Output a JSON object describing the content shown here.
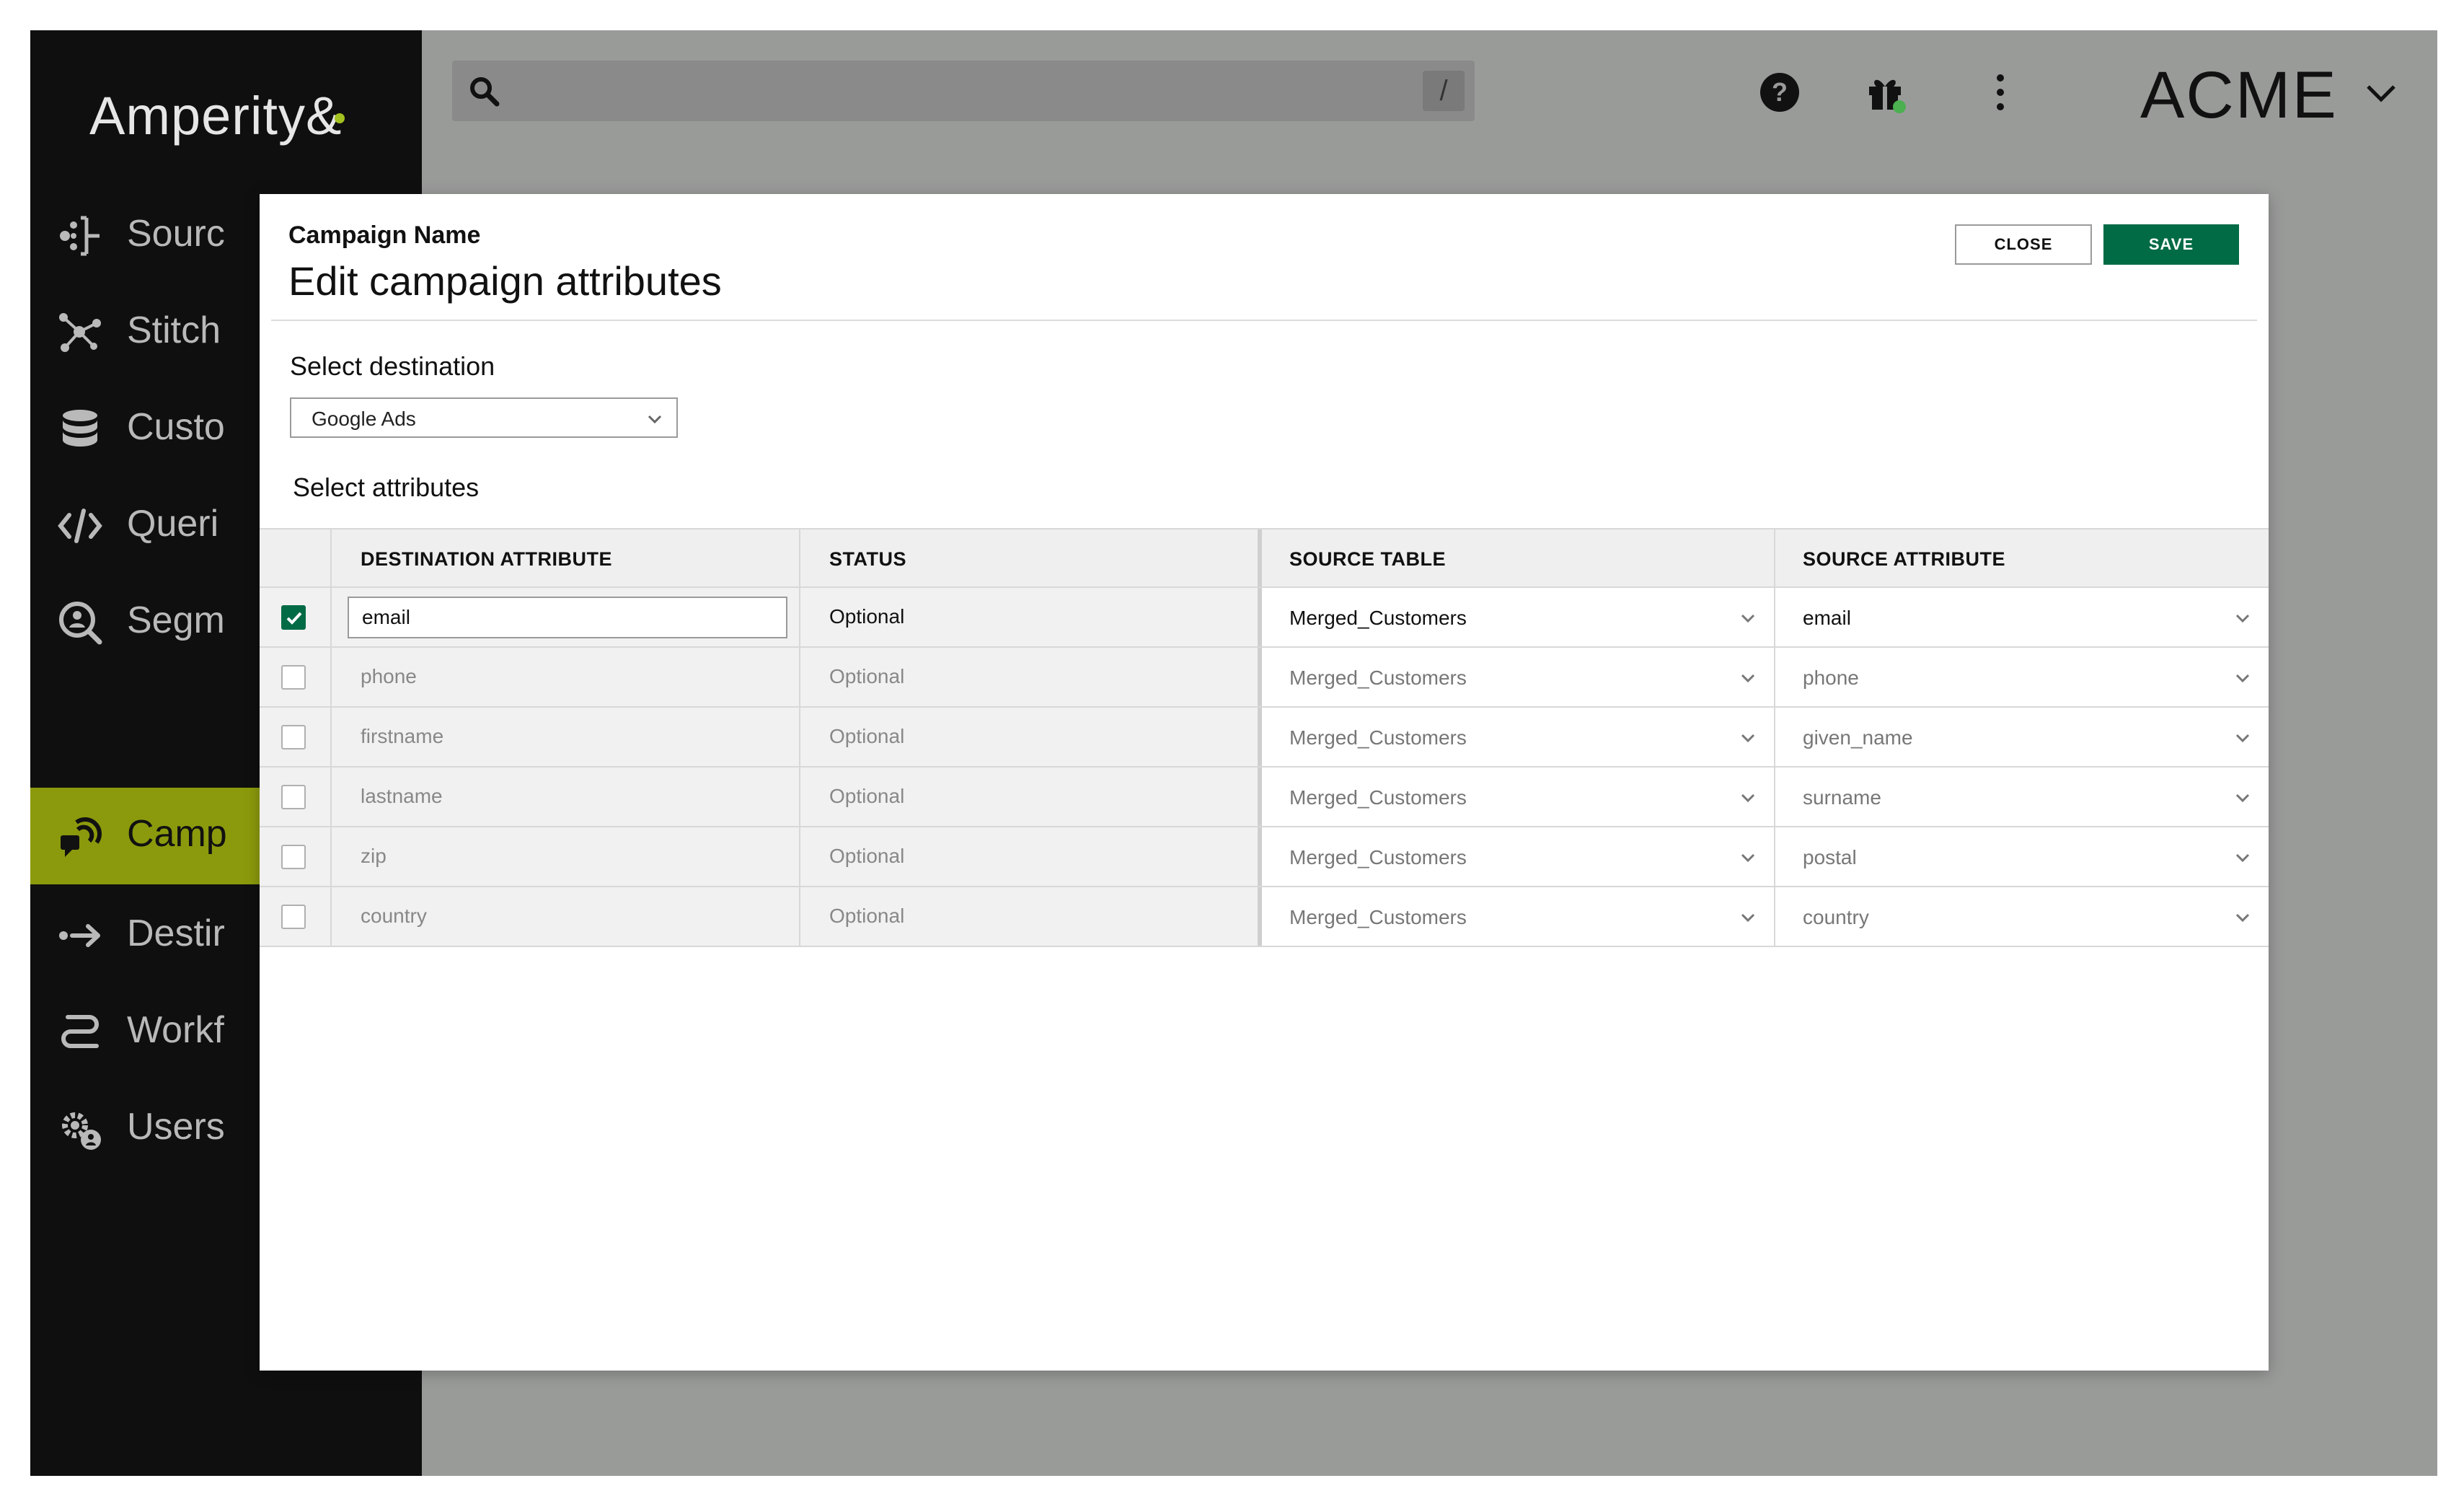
{
  "app": {
    "logo_text": "Amperity",
    "logo_mark": "&"
  },
  "sidebar": {
    "items": [
      {
        "label": "Sourc",
        "icon": "sources-icon",
        "active": false
      },
      {
        "label": "Stitch",
        "icon": "stitch-icon",
        "active": false
      },
      {
        "label": "Custo",
        "icon": "database-icon",
        "active": false
      },
      {
        "label": "Queri",
        "icon": "code-icon",
        "active": false
      },
      {
        "label": "Segm",
        "icon": "segment-search-icon",
        "active": false
      },
      {
        "label": "Camp",
        "icon": "campaign-icon",
        "active": true
      },
      {
        "label": "Destir",
        "icon": "destination-arrow-icon",
        "active": false
      },
      {
        "label": "Workf",
        "icon": "workflow-icon",
        "active": false
      },
      {
        "label": "Users",
        "icon": "users-gear-icon",
        "active": false
      }
    ]
  },
  "topbar": {
    "search_shortcut": "/",
    "org_name": "ACME",
    "icons": [
      "help-icon",
      "gift-icon",
      "more-vertical-icon"
    ],
    "notification_color": "#4caf50"
  },
  "modal": {
    "campaign_name": "Campaign Name",
    "title": "Edit campaign attributes",
    "close_label": "CLOSE",
    "save_label": "SAVE",
    "select_destination_label": "Select destination",
    "destination_value": "Google Ads",
    "select_attributes_label": "Select attributes",
    "table": {
      "headers": {
        "destination_attribute": "DESTINATION ATTRIBUTE",
        "status": "STATUS",
        "source_table": "SOURCE TABLE",
        "source_attribute": "SOURCE ATTRIBUTE"
      },
      "rows": [
        {
          "checked": true,
          "destination_attribute": "email",
          "status": "Optional",
          "source_table": "Merged_Customers",
          "source_attribute": "email"
        },
        {
          "checked": false,
          "destination_attribute": "phone",
          "status": "Optional",
          "source_table": "Merged_Customers",
          "source_attribute": "phone"
        },
        {
          "checked": false,
          "destination_attribute": "firstname",
          "status": "Optional",
          "source_table": "Merged_Customers",
          "source_attribute": "given_name"
        },
        {
          "checked": false,
          "destination_attribute": "lastname",
          "status": "Optional",
          "source_table": "Merged_Customers",
          "source_attribute": "surname"
        },
        {
          "checked": false,
          "destination_attribute": "zip",
          "status": "Optional",
          "source_table": "Merged_Customers",
          "source_attribute": "postal"
        },
        {
          "checked": false,
          "destination_attribute": "country",
          "status": "Optional",
          "source_table": "Merged_Customers",
          "source_attribute": "country"
        }
      ]
    }
  },
  "colors": {
    "accent_green": "#006b45",
    "active_nav": "#8b9a0c",
    "sidebar_bg": "#0f0f0f",
    "overlay": "#999b99"
  }
}
